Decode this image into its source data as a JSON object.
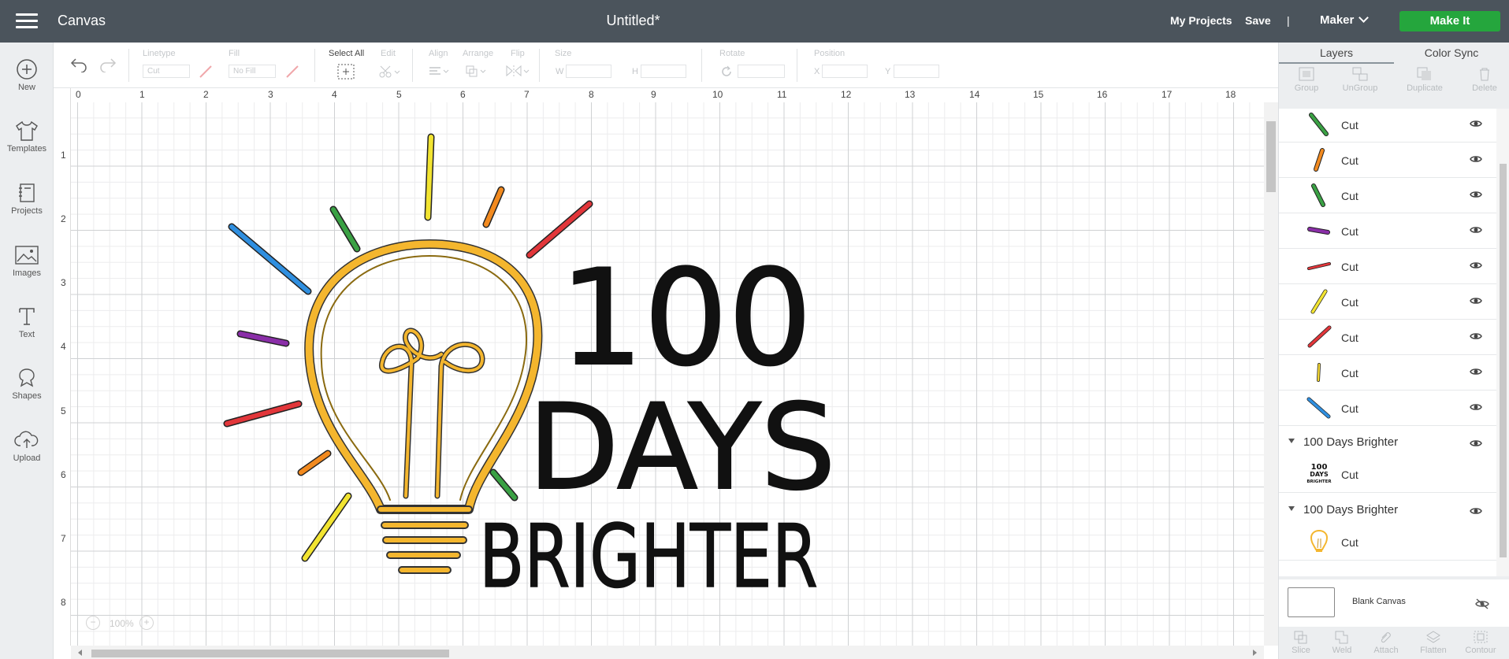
{
  "header": {
    "app_title": "Canvas",
    "doc_title": "Untitled*",
    "my_projects": "My Projects",
    "save": "Save",
    "divider": "|",
    "machine": "Maker",
    "make_it": "Make It"
  },
  "sidebar": {
    "items": [
      {
        "label": "New",
        "icon": "plus-circle-icon"
      },
      {
        "label": "Templates",
        "icon": "shirt-icon"
      },
      {
        "label": "Projects",
        "icon": "notebook-icon"
      },
      {
        "label": "Images",
        "icon": "image-icon"
      },
      {
        "label": "Text",
        "icon": "text-icon"
      },
      {
        "label": "Shapes",
        "icon": "shapes-icon"
      },
      {
        "label": "Upload",
        "icon": "cloud-upload-icon"
      }
    ]
  },
  "toolbar": {
    "linetype_label": "Linetype",
    "linetype_value": "Cut",
    "fill_label": "Fill",
    "fill_value": "No Fill",
    "select_all": "Select All",
    "edit": "Edit",
    "align": "Align",
    "arrange": "Arrange",
    "flip": "Flip",
    "size": "Size",
    "w": "W",
    "h": "H",
    "rotate": "Rotate",
    "position": "Position",
    "x": "X",
    "y": "Y"
  },
  "ruler": {
    "h": [
      "0",
      "1",
      "2",
      "3",
      "4",
      "5",
      "6",
      "7",
      "8",
      "9",
      "10",
      "11",
      "12",
      "13",
      "14",
      "15",
      "16",
      "17",
      "18"
    ],
    "v": [
      "1",
      "2",
      "3",
      "4",
      "5",
      "6",
      "7",
      "8"
    ]
  },
  "zoom": {
    "value": "100%",
    "minus": "−",
    "plus": "+"
  },
  "design": {
    "line1": "100",
    "line2": "DAYS",
    "line3": "BRIGHTER"
  },
  "right_panel": {
    "tabs": [
      "Layers",
      "Color Sync"
    ],
    "layer_tools": [
      "Group",
      "UnGroup",
      "Duplicate",
      "Delete"
    ],
    "layers": [
      {
        "label": "Cut",
        "color": "#3aa144"
      },
      {
        "label": "Cut",
        "color": "#f28a1f"
      },
      {
        "label": "Cut",
        "color": "#3aa144"
      },
      {
        "label": "Cut",
        "color": "#8a2ea8"
      },
      {
        "label": "Cut",
        "color": "#e2363a"
      },
      {
        "label": "Cut",
        "color": "#f2e431"
      },
      {
        "label": "Cut",
        "color": "#e2363a"
      },
      {
        "label": "Cut",
        "color": "#f2d531"
      },
      {
        "label": "Cut",
        "color": "#2f8fe0"
      }
    ],
    "groups": [
      {
        "name": "100 Days Brighter",
        "layer": "Cut",
        "thumb": "text-thumb",
        "thumb_lines": [
          "100",
          "DAYS",
          "BRIGHTER"
        ]
      },
      {
        "name": "100 Days Brighter",
        "layer": "Cut",
        "thumb": "bulb-thumb"
      }
    ],
    "blank_canvas": "Blank Canvas",
    "bottom_tools": [
      "Slice",
      "Weld",
      "Attach",
      "Flatten",
      "Contour"
    ]
  }
}
